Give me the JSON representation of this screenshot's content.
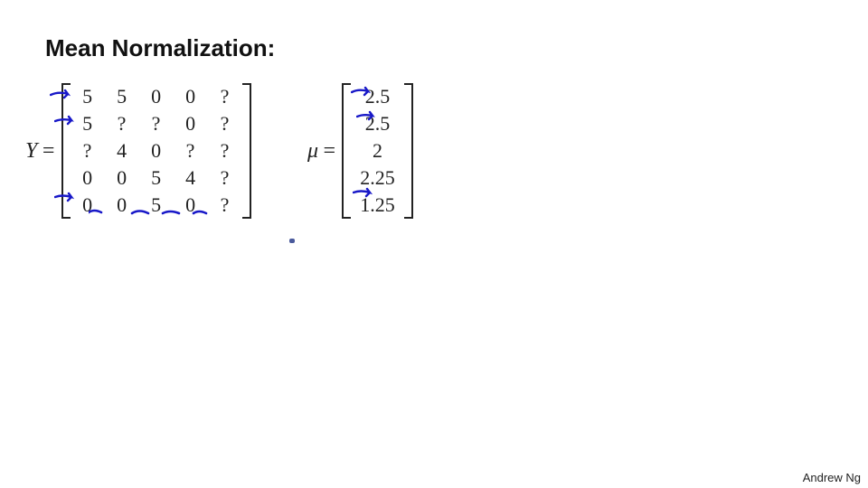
{
  "title": "Mean Normalization:",
  "Y_label": "Y",
  "equals": "=",
  "mu_label": "μ",
  "author": "Andrew Ng",
  "chart_data": {
    "type": "table",
    "title": "Ratings matrix Y and per-movie mean vector μ",
    "Y_matrix": {
      "rows": [
        [
          "5",
          "5",
          "0",
          "0",
          "?"
        ],
        [
          "5",
          "?",
          "?",
          "0",
          "?"
        ],
        [
          "?",
          "4",
          "0",
          "?",
          "?"
        ],
        [
          "0",
          "0",
          "5",
          "4",
          "?"
        ],
        [
          "0",
          "0",
          "5",
          "0",
          "?"
        ]
      ]
    },
    "mu_vector": {
      "values": [
        "2.5",
        "2.5",
        "2",
        "2.25",
        "1.25"
      ]
    }
  },
  "arrow_targets": {
    "Y_rows_pointed": [
      1,
      2,
      5
    ],
    "mu_rows_pointed": [
      1,
      2,
      5
    ]
  }
}
